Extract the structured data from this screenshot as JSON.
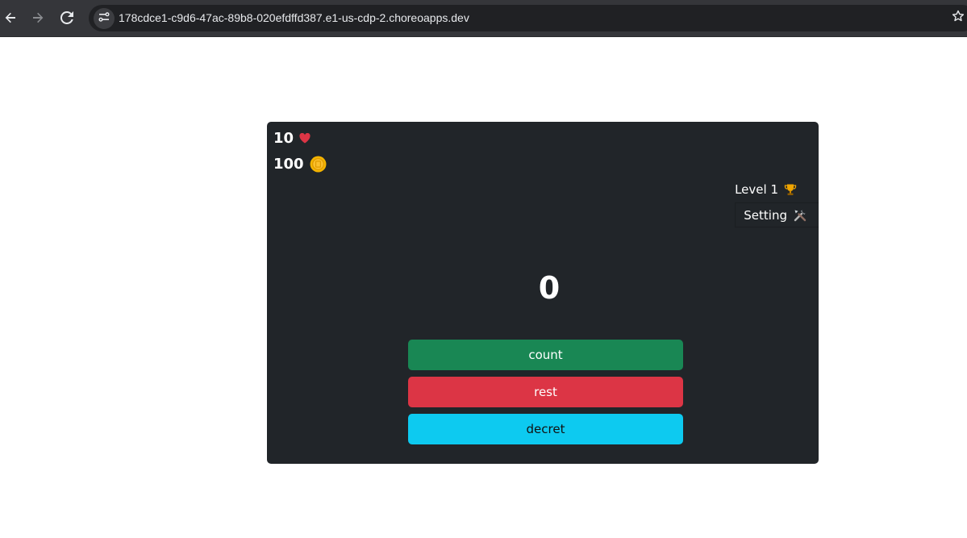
{
  "browser": {
    "url": "178cdce1-c9d6-47ac-89b8-020efdffd387.e1-us-cdp-2.choreoapps.dev",
    "icons": {
      "back": "arrow-left-icon",
      "forward": "arrow-right-icon",
      "reload": "reload-icon",
      "site_info": "tune-icon",
      "bookmark": "star-icon"
    }
  },
  "game": {
    "lives": "10",
    "coins": "100",
    "level_label": "Level 1",
    "setting_label": "Setting",
    "counter": "0",
    "buttons": {
      "count": "count",
      "rest": "rest",
      "decret": "decret"
    },
    "icons": {
      "lives": "heart-icon",
      "coins": "coin-icon",
      "level": "trophy-icon",
      "setting": "tools-icon"
    },
    "colors": {
      "card_bg": "#212529",
      "count_btn": "#198754",
      "rest_btn": "#dc3545",
      "decret_btn": "#0dcaf0",
      "heart": "#dc3545",
      "coin": "#f4b400"
    }
  }
}
